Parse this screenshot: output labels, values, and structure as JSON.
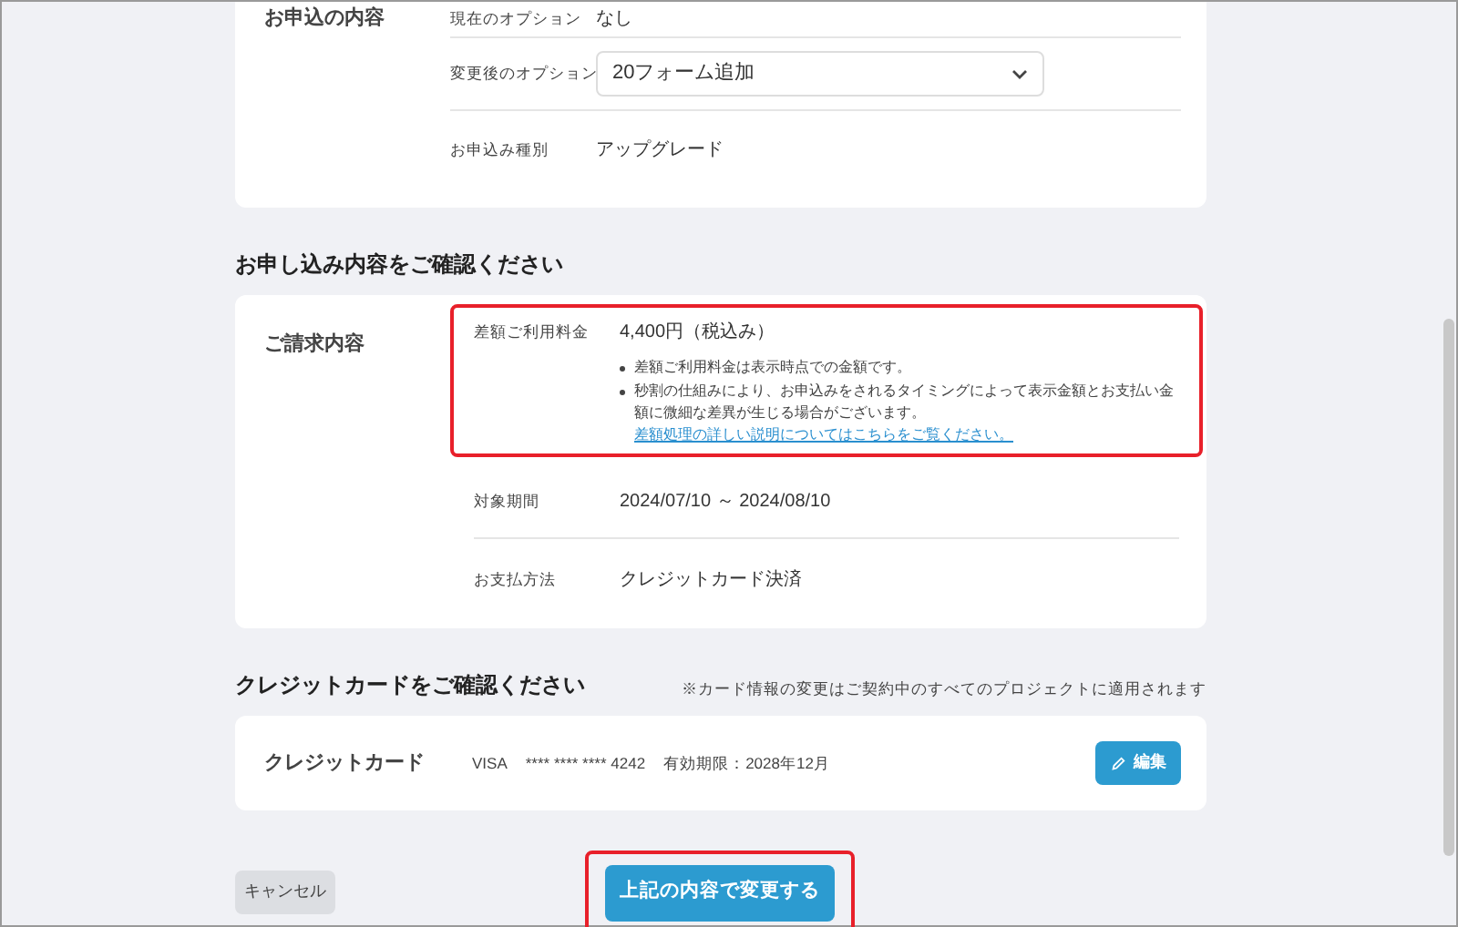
{
  "application": {
    "section_label": "お申込の内容",
    "rows": [
      {
        "kind": "text",
        "label": "現在のオプション",
        "value": "なし"
      },
      {
        "kind": "select",
        "label": "変更後のオプション",
        "value": "20フォーム追加"
      },
      {
        "kind": "text",
        "label": "お申込み種別",
        "value": "アップグレード"
      }
    ]
  },
  "billing": {
    "heading": "お申し込み内容をご確認ください",
    "section_label": "ご請求内容",
    "rows": [
      {
        "label": "差額ご利用料金",
        "value": "4,400円（税込み）",
        "highlighted": true,
        "notes": [
          {
            "text": "差額ご利用料金は表示時点での金額です。"
          },
          {
            "text": "秒割の仕組みにより、お申込みをされるタイミングによって表示金額とお支払い金額に微細な差異が生じる場合がございます。",
            "link": "差額処理の詳しい説明についてはこちらをご覧ください。"
          }
        ]
      },
      {
        "label": "対象期間",
        "value": "2024/07/10 ～ 2024/08/10",
        "highlighted": false
      },
      {
        "label": "お支払方法",
        "value": "クレジットカード決済",
        "highlighted": false
      }
    ]
  },
  "credit_card": {
    "heading": "クレジットカードをご確認ください",
    "note": "※カード情報の変更はご契約中のすべてのプロジェクトに適用されます",
    "label": "クレジットカード",
    "brand": "VISA",
    "number": "**** **** **** 4242",
    "expiry": "有効期限：2028年12月",
    "edit_button": "編集"
  },
  "actions": {
    "cancel": "キャンセル",
    "submit": "上記の内容で変更する",
    "submit_highlighted": true
  }
}
